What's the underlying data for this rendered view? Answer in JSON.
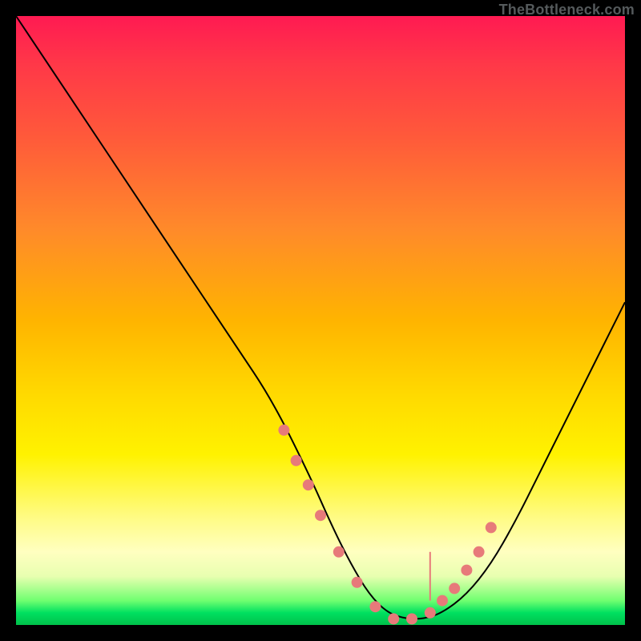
{
  "attribution": "TheBottleneck.com",
  "colors": {
    "gradient_top": "#ff1a52",
    "gradient_mid": "#ffd900",
    "gradient_bottom": "#00c04a",
    "curve": "#000000",
    "dots": "#e77a7a",
    "frame": "#000000"
  },
  "chart_data": {
    "type": "line",
    "title": "",
    "xlabel": "",
    "ylabel": "",
    "xlim": [
      0,
      100
    ],
    "ylim": [
      0,
      100
    ],
    "annotations": [
      "TheBottleneck.com"
    ],
    "series": [
      {
        "name": "bottleneck-curve",
        "x": [
          0,
          6,
          12,
          18,
          24,
          30,
          36,
          42,
          48,
          52,
          55,
          58,
          61,
          64,
          67,
          70,
          74,
          78,
          82,
          86,
          90,
          94,
          98,
          100
        ],
        "y": [
          100,
          91,
          82,
          73,
          64,
          55,
          46,
          37,
          25,
          16,
          10,
          5,
          2,
          1,
          1,
          2,
          5,
          10,
          17,
          25,
          33,
          41,
          49,
          53
        ]
      }
    ],
    "highlight_points": {
      "name": "valley-dots",
      "x": [
        44,
        46,
        48,
        50,
        53,
        56,
        59,
        62,
        65,
        68,
        70,
        72,
        74,
        76,
        78
      ],
      "y": [
        32,
        27,
        23,
        18,
        12,
        7,
        3,
        1,
        1,
        2,
        4,
        6,
        9,
        12,
        16
      ]
    }
  }
}
